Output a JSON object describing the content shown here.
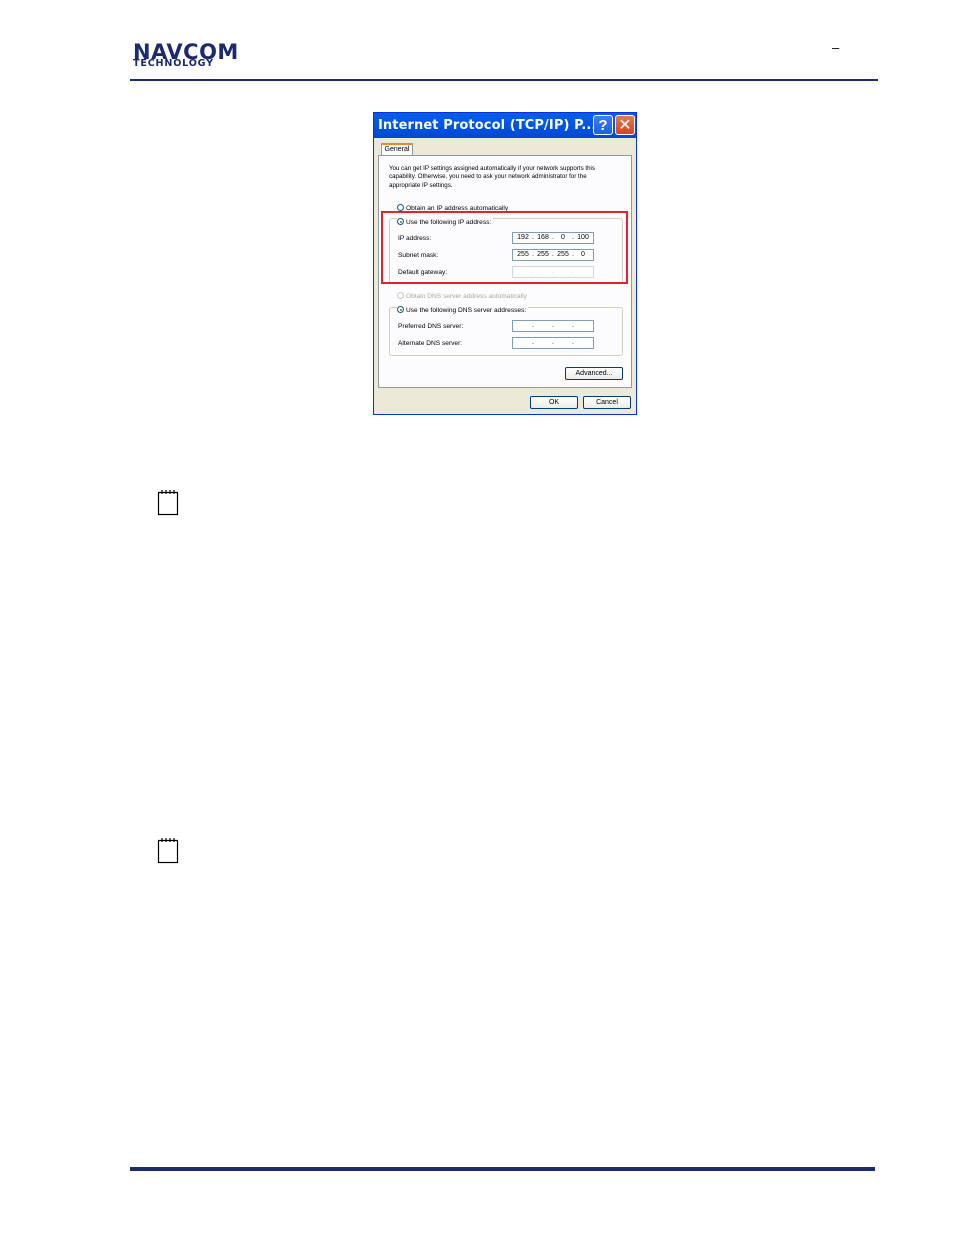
{
  "header": {
    "logo_top": "NAVCOM",
    "logo_bottom": "TECHNOLOGY",
    "dash": "–",
    "brand_color": "#1c2a6e"
  },
  "dialog": {
    "title": "Internet Protocol (TCP/IP) P...",
    "help_label": "?",
    "close_label": "✕",
    "tab_label": "General",
    "description": "You can get IP settings assigned automatically if your network supports this capability. Otherwise, you need to ask your network administrator for the appropriate IP settings.",
    "radio_auto_ip": "Obtain an IP address automatically",
    "radio_static_ip": "Use the following IP address:",
    "ip_label": "IP address:",
    "ip_octets": [
      "192",
      "168",
      "0",
      "100"
    ],
    "mask_label": "Subnet mask:",
    "mask_octets": [
      "255",
      "255",
      "255",
      "0"
    ],
    "gateway_label": "Default gateway:",
    "radio_auto_dns": "Obtain DNS server address automatically",
    "radio_static_dns": "Use the following DNS server addresses:",
    "pref_dns_label": "Preferred DNS server:",
    "alt_dns_label": "Alternate DNS server:",
    "dot": ".",
    "advanced_label": "Advanced...",
    "ok_label": "OK",
    "cancel_label": "Cancel",
    "highlight_color": "#e2242a"
  },
  "icons": {
    "note_icon_1": "notepad-icon",
    "note_icon_2": "notepad-icon"
  }
}
